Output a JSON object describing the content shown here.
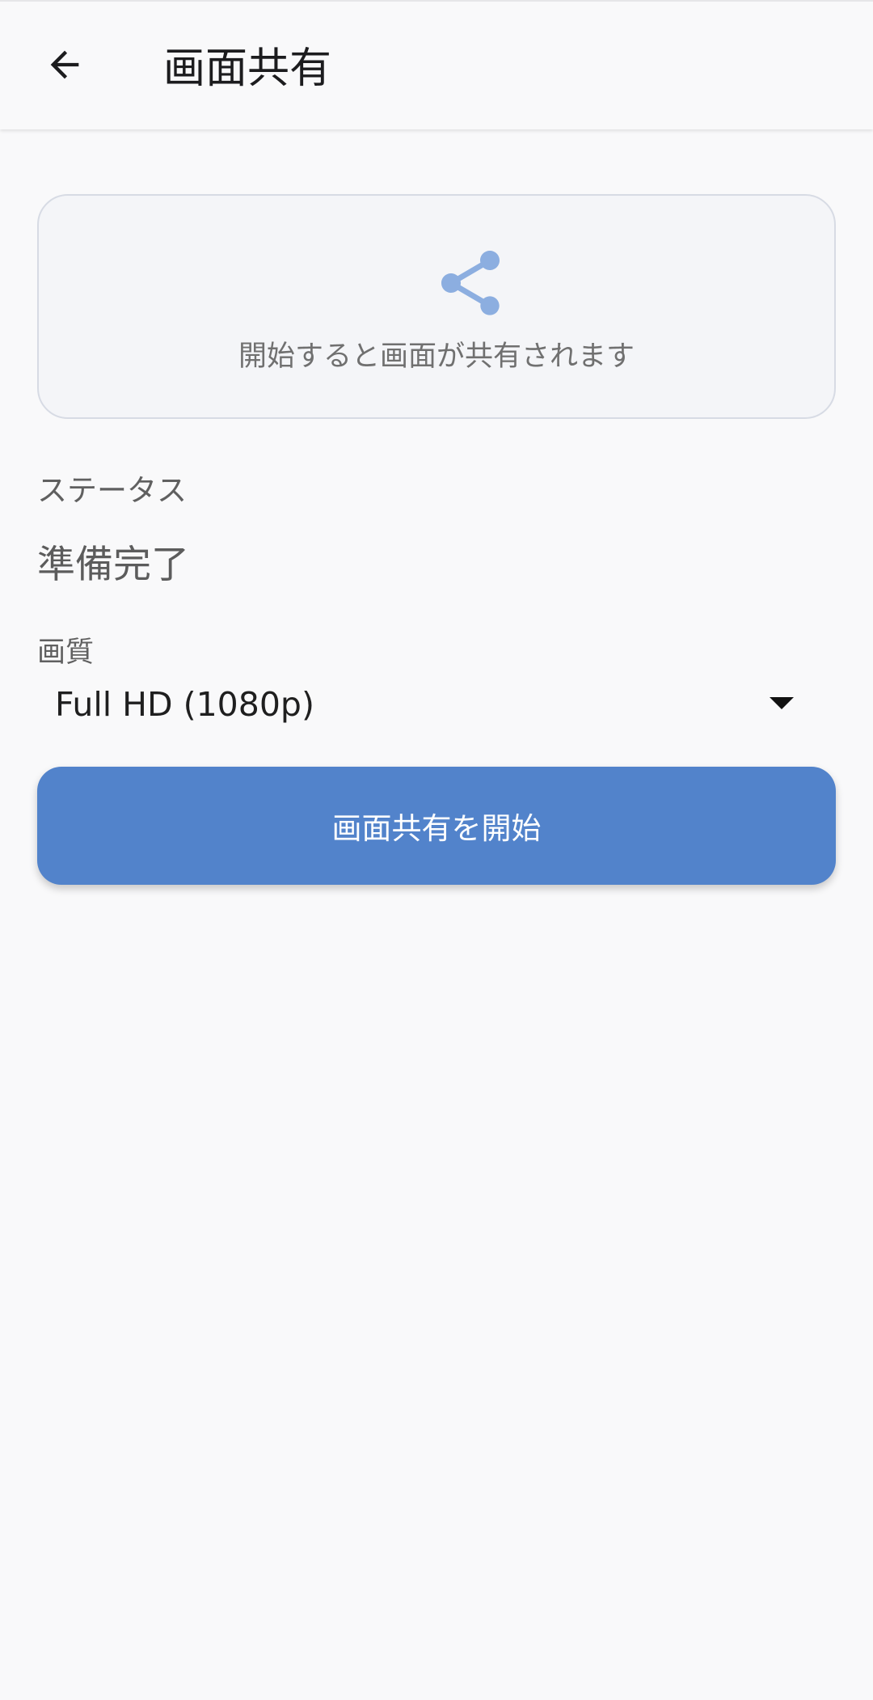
{
  "app_bar": {
    "back_icon": "arrow-left-icon",
    "title": "画面共有"
  },
  "preview": {
    "icon": "share-icon",
    "icon_color": "#8caee0",
    "caption": "開始すると画面が共有されます"
  },
  "status": {
    "label": "ステータス",
    "value": "準備完了"
  },
  "quality": {
    "label": "画質",
    "selected": "Full HD (1080p)"
  },
  "start_button": {
    "label": "画面共有を開始",
    "color": "#5283cb"
  }
}
